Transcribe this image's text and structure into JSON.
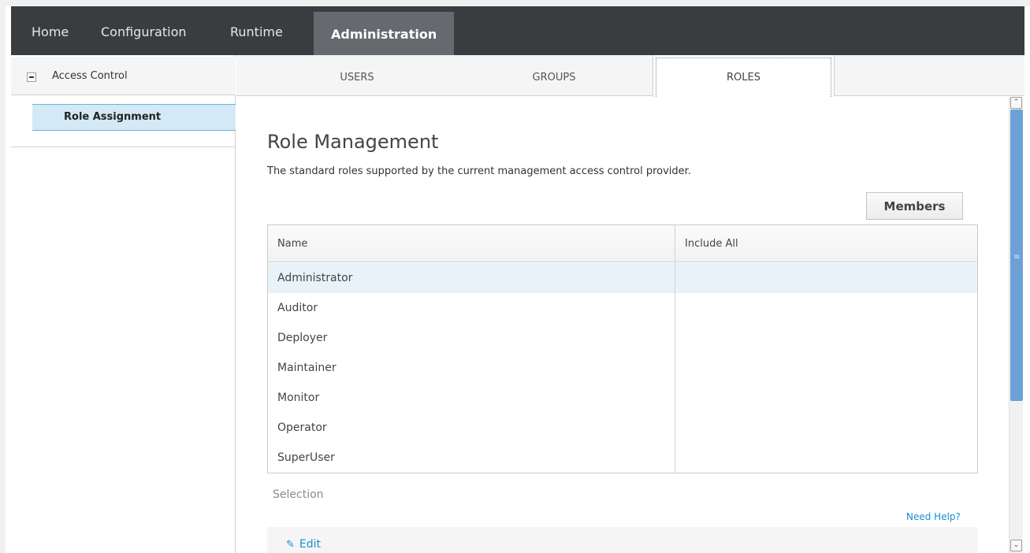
{
  "nav": {
    "items": [
      {
        "label": "Home"
      },
      {
        "label": "Configuration"
      },
      {
        "label": "Runtime"
      },
      {
        "label": "Administration",
        "active": true
      }
    ]
  },
  "sidebar": {
    "header": "Access Control",
    "items": [
      {
        "label": "Role Assignment",
        "selected": true
      }
    ]
  },
  "tabs": [
    {
      "label": "USERS"
    },
    {
      "label": "GROUPS"
    },
    {
      "label": "ROLES",
      "active": true
    }
  ],
  "main": {
    "title": "Role Management",
    "description": "The standard roles supported by the current management access control provider.",
    "members_button": "Members",
    "table": {
      "columns": [
        "Name",
        "Include All"
      ],
      "rows": [
        {
          "name": "Administrator",
          "include_all": "",
          "selected": true
        },
        {
          "name": "Auditor",
          "include_all": ""
        },
        {
          "name": "Deployer",
          "include_all": ""
        },
        {
          "name": "Maintainer",
          "include_all": ""
        },
        {
          "name": "Monitor",
          "include_all": ""
        },
        {
          "name": "Operator",
          "include_all": ""
        },
        {
          "name": "SuperUser",
          "include_all": ""
        }
      ]
    },
    "selection_label": "Selection",
    "help_link": "Need Help?",
    "edit_label": "Edit"
  },
  "colors": {
    "nav_bg": "#3a3d40",
    "nav_active": "#666a6e",
    "selected_row": "#e8f2f9",
    "link": "#1a8fd0",
    "scroll_thumb": "#6da0d7"
  }
}
